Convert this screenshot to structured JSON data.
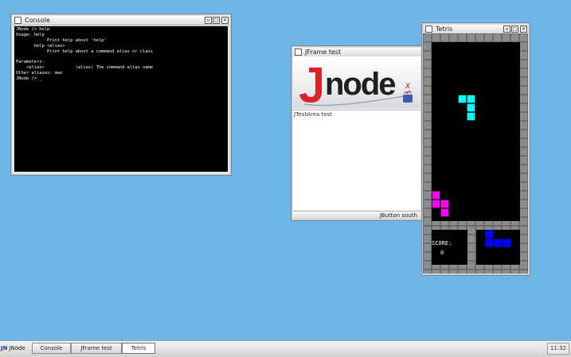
{
  "console": {
    "title": "Console",
    "lines": [
      "JNode /> help",
      "Usage: help",
      "            Print help about 'help'",
      "       help <alias>",
      "            Print help about a command alias or class",
      "",
      "Parameters:",
      "    <alias>            (alias) The command alias name",
      "Other aliases: man",
      "JNode /> _"
    ]
  },
  "jframe": {
    "title": "JFrame test",
    "textarea": "JTextArea test",
    "button": "JButton south"
  },
  "tetris": {
    "title": "Tetris",
    "score_label": "SCORE:",
    "score_value": "0",
    "colors": {
      "frame": "#5e5e5e",
      "cell": "#8c8c8c",
      "board": "#000000",
      "falling": "#00ffff",
      "stack": "#ff00ff",
      "next": "#0000ff"
    }
  },
  "taskbar": {
    "start_label": "JNode",
    "start_icon": "JN",
    "tasks": [
      "Console",
      "JFrame test",
      "Tetris"
    ],
    "active_task": "Tetris",
    "clock": "11:32"
  }
}
